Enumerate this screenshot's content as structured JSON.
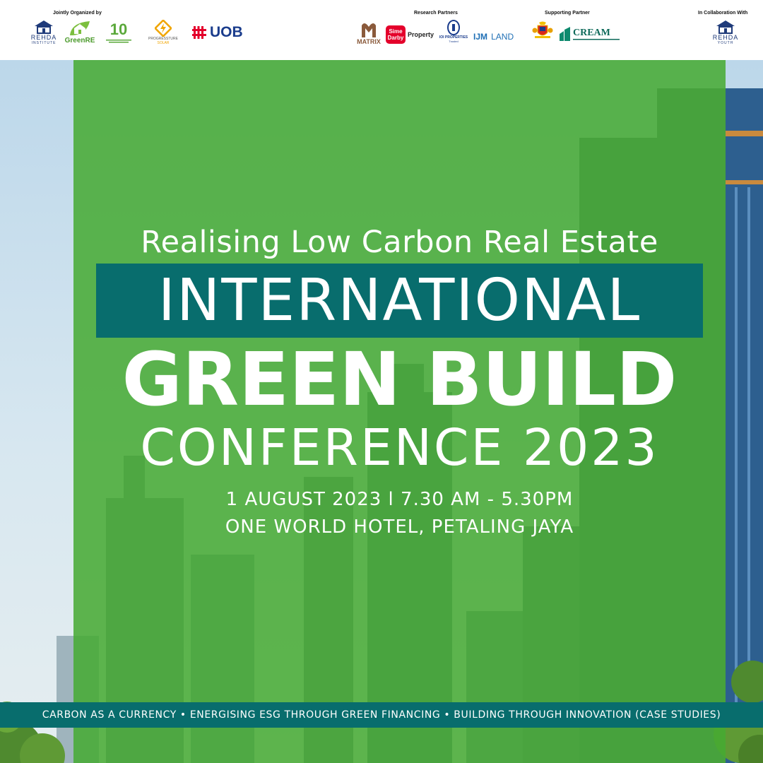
{
  "header": {
    "jointly_label": "Jointly Organized by",
    "research_label": "Research Partners",
    "supporting_label": "Supporting Partner",
    "collab_label": "In Collaboration With",
    "logos": {
      "rehda_name": "REHDA",
      "rehda_sub": "INSTITUTE",
      "greenre": "GreenRE",
      "ten_years": "10",
      "progressture": "PROGRESSTURE",
      "progressture_sub": "SOLAR",
      "uob": "UOB",
      "matrix": "MATRIX",
      "sime_darby_top": "Sime",
      "sime_darby_bottom": "Darby",
      "sime_property": "Property",
      "ioi": "IOI PROPERTIES",
      "ioi_sub": "Trusted",
      "ijm": "IJM",
      "ijm_land": "LAND",
      "cream": "CREAM",
      "rehda_youth_name": "REHDA",
      "rehda_youth_sub": "YOUTH"
    }
  },
  "main": {
    "tagline": "Realising Low Carbon Real Estate",
    "international": "INTERNATIONAL",
    "green_build": "GREEN BUILD",
    "conference": "CONFERENCE 2023",
    "date_time": "1 AUGUST 2023 l 7.30 AM - 5.30PM",
    "venue": "ONE WORLD HOTEL, PETALING JAYA"
  },
  "themes_bar": {
    "text": "CARBON AS A CURRENCY • ENERGISING ESG THROUGH GREEN FINANCING • BUILDING THROUGH INNOVATION (CASE STUDIES)"
  },
  "colors": {
    "green_overlay": "#46aa32",
    "teal": "#086d6d",
    "uob_red": "#e4002b",
    "uob_blue": "#1a3c8c"
  },
  "icons": [
    "rehda-house-icon",
    "greenre-leaf-icon",
    "progressture-bolt-icon",
    "uob-grid-icon",
    "matrix-m-icon",
    "ioi-seal-icon",
    "malaysia-crest-icon",
    "cream-building-icon",
    "rehda-youth-house-icon"
  ]
}
